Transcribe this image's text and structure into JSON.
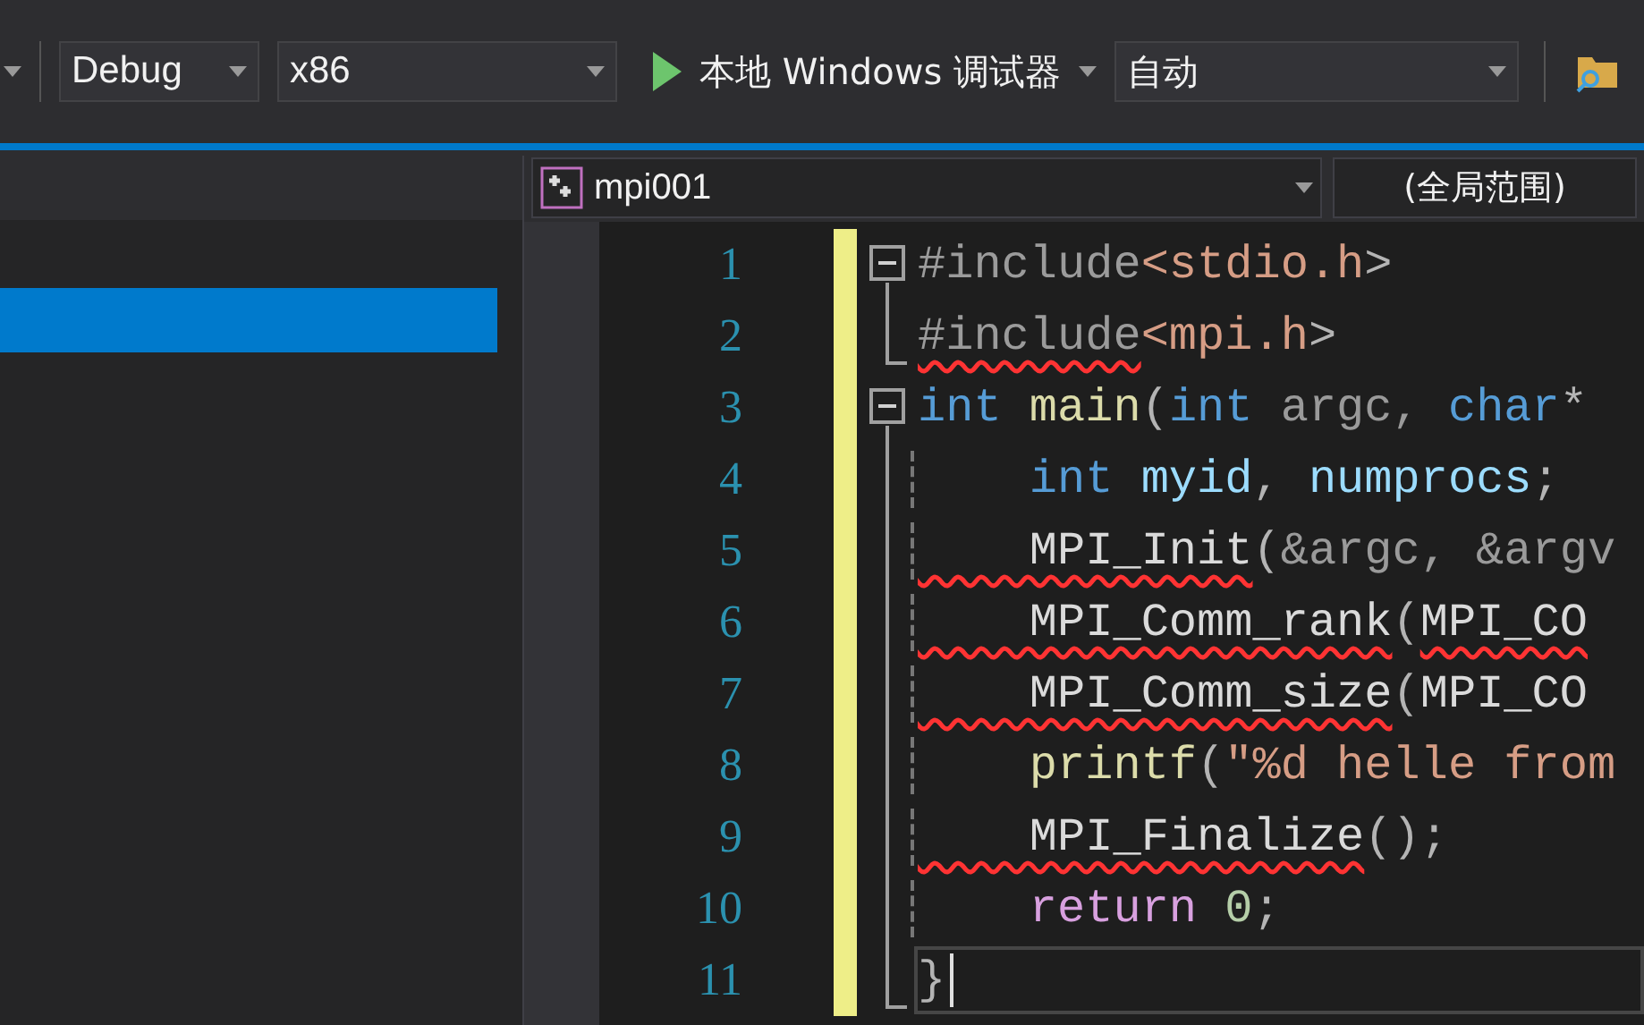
{
  "toolbar": {
    "configuration": "Debug",
    "platform": "x86",
    "run_button": "本地 Windows 调试器",
    "mode": "自动"
  },
  "navigation": {
    "file_scope": "mpi001",
    "global_scope": "(全局范围)"
  },
  "sidebar": {
    "items": [
      {
        "selected": true
      }
    ]
  },
  "editor": {
    "lines": [
      {
        "number": "1",
        "kind": "fold_start",
        "current": false,
        "tokens": [
          {
            "kind": "preproc",
            "text": "#include"
          },
          {
            "kind": "string",
            "text": "<stdio.h"
          },
          {
            "kind": "punct",
            "text": ">"
          }
        ]
      },
      {
        "number": "2",
        "kind": "fold_end",
        "current": false,
        "tokens": [
          {
            "kind": "preproc",
            "text": "#include",
            "error": true
          },
          {
            "kind": "string",
            "text": "<mpi.h"
          },
          {
            "kind": "punct",
            "text": ">"
          }
        ]
      },
      {
        "number": "3",
        "kind": "fold_start",
        "current": false,
        "tokens": [
          {
            "kind": "keyword",
            "text": "int"
          },
          {
            "kind": "function",
            "text": " main"
          },
          {
            "kind": "punct",
            "text": "("
          },
          {
            "kind": "keyword",
            "text": "int"
          },
          {
            "kind": "param",
            "text": " argc, "
          },
          {
            "kind": "keyword",
            "text": "char"
          },
          {
            "kind": "punct",
            "text": "*"
          }
        ]
      },
      {
        "number": "4",
        "kind": "fold_inner",
        "current": false,
        "tokens": [
          {
            "kind": "keyword",
            "text": "    int"
          },
          {
            "kind": "variable",
            "text": " myid"
          },
          {
            "kind": "punct",
            "text": ", "
          },
          {
            "kind": "variable",
            "text": "numprocs"
          },
          {
            "kind": "punct",
            "text": ";"
          }
        ]
      },
      {
        "number": "5",
        "kind": "fold_inner",
        "current": false,
        "tokens": [
          {
            "kind": "macro",
            "text": "    MPI_Init",
            "error": true
          },
          {
            "kind": "punct",
            "text": "("
          },
          {
            "kind": "param",
            "text": "&argc, &argv"
          }
        ]
      },
      {
        "number": "6",
        "kind": "fold_inner",
        "current": false,
        "tokens": [
          {
            "kind": "macro",
            "text": "    MPI_Comm_rank",
            "error": true
          },
          {
            "kind": "punct",
            "text": "("
          },
          {
            "kind": "macro",
            "text": "MPI_CO",
            "error": true
          }
        ]
      },
      {
        "number": "7",
        "kind": "fold_inner",
        "current": false,
        "tokens": [
          {
            "kind": "macro",
            "text": "    MPI_Comm_size",
            "error": true
          },
          {
            "kind": "punct",
            "text": "("
          },
          {
            "kind": "macro",
            "text": "MPI_CO"
          }
        ]
      },
      {
        "number": "8",
        "kind": "fold_inner",
        "current": false,
        "tokens": [
          {
            "kind": "function",
            "text": "    printf"
          },
          {
            "kind": "punct",
            "text": "("
          },
          {
            "kind": "string",
            "text": "\"%d helle from"
          }
        ]
      },
      {
        "number": "9",
        "kind": "fold_inner",
        "current": false,
        "tokens": [
          {
            "kind": "macro",
            "text": "    MPI_Finalize",
            "error": true
          },
          {
            "kind": "punct",
            "text": "();"
          }
        ]
      },
      {
        "number": "10",
        "kind": "fold_inner",
        "current": false,
        "tokens": [
          {
            "kind": "control",
            "text": "    return"
          },
          {
            "kind": "number",
            "text": " 0"
          },
          {
            "kind": "punct",
            "text": ";"
          }
        ]
      },
      {
        "number": "11",
        "kind": "fold_end",
        "current": true,
        "tokens": [
          {
            "kind": "punct",
            "text": "}"
          }
        ]
      }
    ]
  }
}
